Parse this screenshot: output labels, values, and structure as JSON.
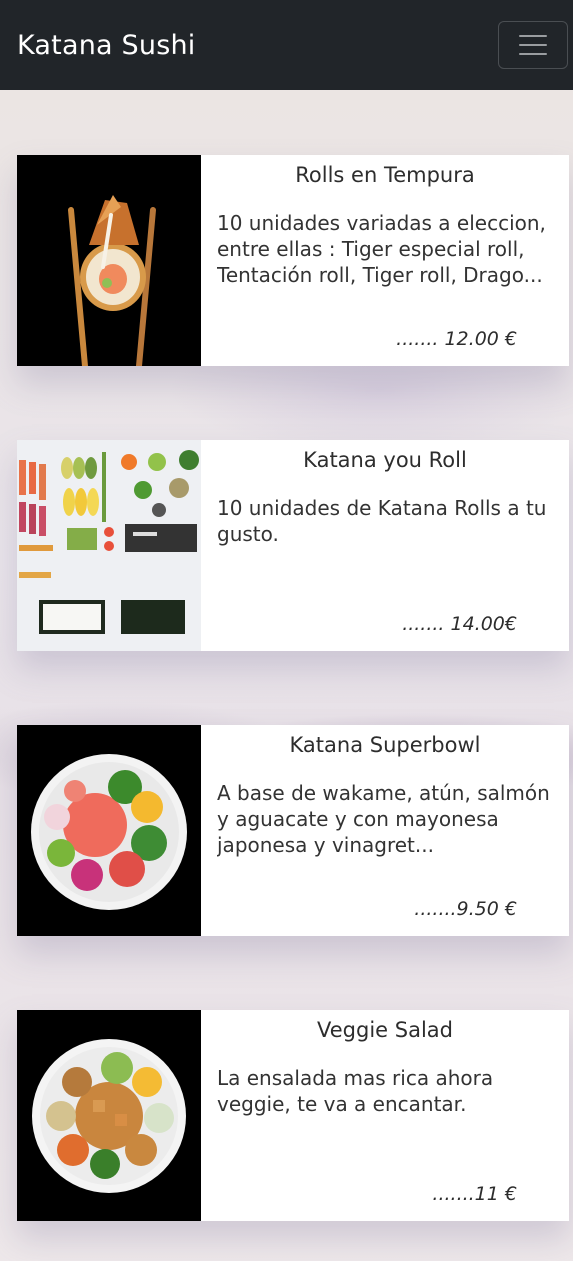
{
  "navbar": {
    "brand": "Katana Sushi",
    "menu_icon": "hamburger-menu-icon"
  },
  "products": [
    {
      "title": "Rolls en Tempura",
      "description": "10 unidades variadas a eleccion, entre ellas : Tiger especial roll, Tentación roll, Tiger roll, Drago...",
      "price": "....... 12.00 €",
      "image": "tempura-roll-chopsticks-image"
    },
    {
      "title": "Katana you Roll",
      "description": "10 unidades de Katana Rolls a tu gusto.",
      "price": "....... 14.00€",
      "image": "sushi-ingredients-image"
    },
    {
      "title": "Katana Superbowl",
      "description": "A base de wakame, atún, salmón y aguacate y con mayonesa japonesa y vinagret...",
      "price": ".......9.50 €",
      "image": "poke-bowl-image"
    },
    {
      "title": "Veggie Salad",
      "description": "La ensalada mas rica ahora veggie, te va a encantar.",
      "price": ".......11 €",
      "image": "veggie-salad-bowl-image"
    }
  ]
}
